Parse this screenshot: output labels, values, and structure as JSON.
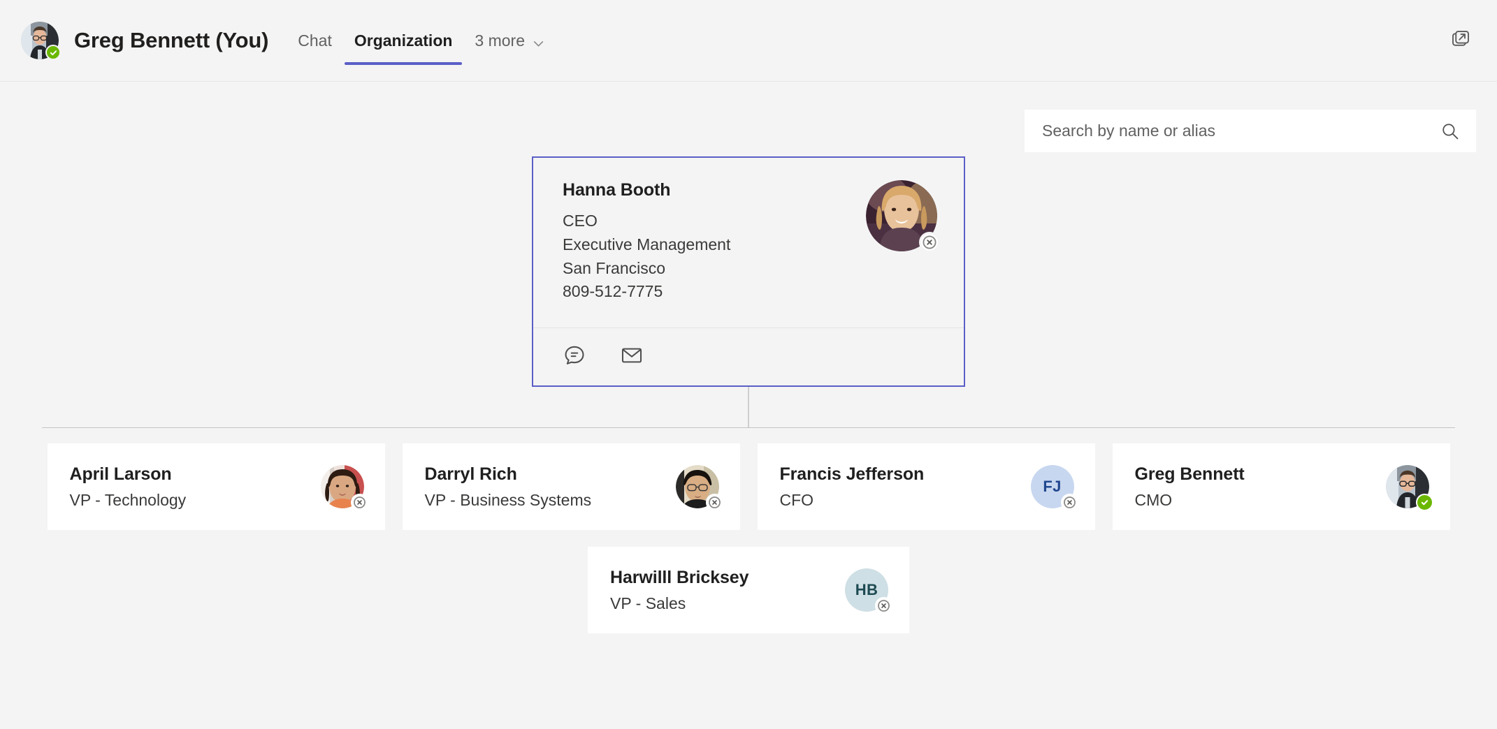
{
  "header": {
    "user_name": "Greg Bennett (You)",
    "user_status": "available",
    "avatar_icon": "user-photo-greg-bennett",
    "tabs": [
      {
        "label": "Chat",
        "active": false
      },
      {
        "label": "Organization",
        "active": true
      }
    ],
    "more_tabs_label": "3 more",
    "more_tabs_icon": "chevron-down-icon",
    "popout_icon": "open-in-new-window-icon",
    "accent_color": "#5b5fc7"
  },
  "search": {
    "placeholder": "Search by name or alias",
    "value": "",
    "icon": "search-icon"
  },
  "org": {
    "root": {
      "name": "Hanna Booth",
      "role": "CEO",
      "department": "Executive Management",
      "location": "San Francisco",
      "phone": "809-512-7775",
      "status": "offline",
      "avatar_icon": "user-photo-hanna-booth",
      "selected": true,
      "actions": [
        {
          "label": "Chat",
          "icon": "chat-bubble-icon"
        },
        {
          "label": "Email",
          "icon": "envelope-icon"
        }
      ]
    },
    "children": [
      {
        "name": "April Larson",
        "role": "VP - Technology",
        "status": "offline",
        "avatar_type": "photo",
        "avatar_icon": "user-photo-april-larson"
      },
      {
        "name": "Darryl Rich",
        "role": "VP - Business Systems",
        "status": "offline",
        "avatar_type": "photo",
        "avatar_icon": "user-photo-darryl-rich"
      },
      {
        "name": "Francis Jefferson",
        "role": "CFO",
        "status": "offline",
        "avatar_type": "initials",
        "initials": "FJ",
        "initials_color": "blue"
      },
      {
        "name": "Greg Bennett",
        "role": "CMO",
        "status": "available",
        "avatar_type": "photo",
        "avatar_icon": "user-photo-greg-bennett"
      }
    ],
    "children_second_row": [
      {
        "name": "Harwilll Bricksey",
        "role": "VP - Sales",
        "status": "offline",
        "avatar_type": "initials",
        "initials": "HB",
        "initials_color": "teal"
      }
    ]
  },
  "colors": {
    "page_background": "#f4f4f4",
    "card_background": "#ffffff",
    "accent": "#5b5fc7",
    "available": "#6bb700",
    "offline_badge": "#8a8886",
    "connector": "#c4c4c4"
  }
}
